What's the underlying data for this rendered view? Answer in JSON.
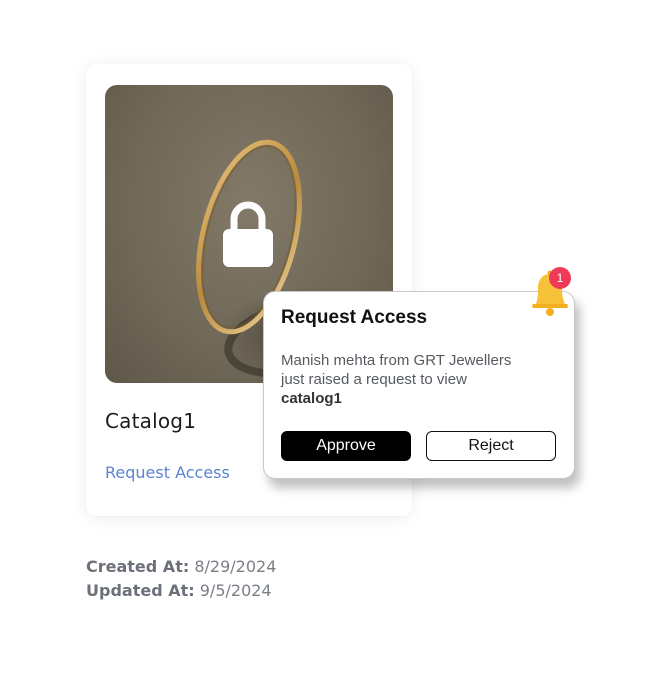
{
  "card": {
    "title": "Catalog1",
    "request_link": "Request Access",
    "lock_icon": "lock-icon",
    "image": "gold-ring-photo"
  },
  "meta": {
    "created_label": "Created At:",
    "created_value": "8/29/2024",
    "updated_label": "Updated At:",
    "updated_value": "9/5/2024"
  },
  "popup": {
    "title": "Request Access",
    "message_line1": "Manish mehta from GRT Jewellers",
    "message_line2": "just raised a request to view",
    "message_emphasis": "catalog1",
    "approve_label": "Approve",
    "reject_label": "Reject"
  },
  "notification": {
    "icon": "bell-icon",
    "count": "1"
  },
  "colors": {
    "link": "#5b82d6",
    "badge": "#ef3a57",
    "bell": "#f7c23a",
    "approve_bg": "#000000"
  }
}
